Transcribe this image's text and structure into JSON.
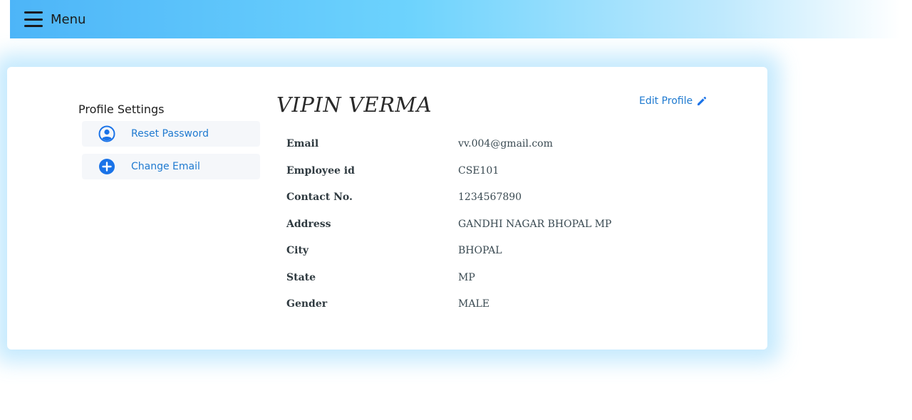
{
  "topbar": {
    "menu_label": "Menu"
  },
  "sidebar": {
    "title": "Profile Settings",
    "items": [
      {
        "label": "Reset Password",
        "icon": "user-circle-icon"
      },
      {
        "label": "Change Email",
        "icon": "plus-circle-icon"
      }
    ]
  },
  "profile": {
    "name": "VIPIN VERMA",
    "edit_label": "Edit Profile",
    "edit_icon": "pencil-icon",
    "fields": [
      {
        "key": "Email",
        "value": "vv.004@gmail.com"
      },
      {
        "key": "Employee id",
        "value": "CSE101"
      },
      {
        "key": "Contact No.",
        "value": "1234567890"
      },
      {
        "key": "Address",
        "value": "GANDHI NAGAR BHOPAL MP"
      },
      {
        "key": "City",
        "value": "BHOPAL"
      },
      {
        "key": "State",
        "value": "MP"
      },
      {
        "key": "Gender",
        "value": "MALE"
      }
    ]
  },
  "colors": {
    "accent": "#1f7ad0",
    "icon_blue": "#1a73e8",
    "topbar_start": "#4db5f8",
    "topbar_end": "#ffffff"
  }
}
